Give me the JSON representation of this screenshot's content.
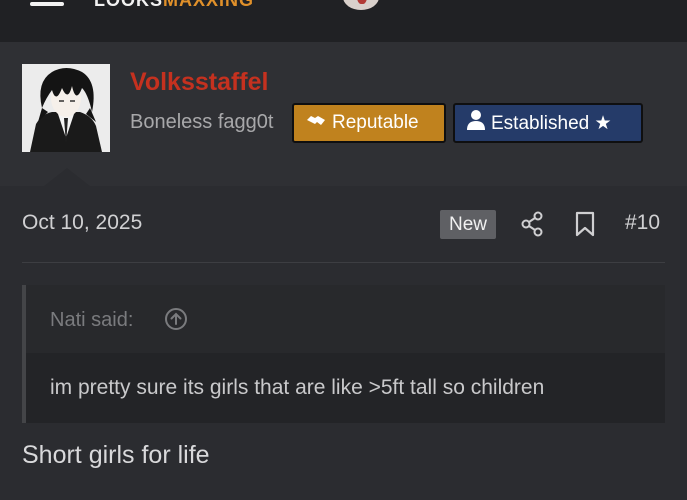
{
  "nav": {
    "logo_part1": "LOOKS",
    "logo_part2": "MAXXING"
  },
  "post": {
    "username": "Volksstaffel",
    "user_title": "Boneless fagg0t",
    "badges": [
      {
        "label": "Reputable",
        "icon": "handshake-icon",
        "color": "#c0821e"
      },
      {
        "label": "Established ★",
        "icon": "user-icon",
        "color": "#253b69"
      }
    ],
    "date": "Oct 10, 2025",
    "new_label": "New",
    "post_number": "#10",
    "quote": {
      "author": "Nati said:",
      "text": "im pretty sure its girls that are like >5ft tall so children"
    },
    "message": "Short girls for life"
  },
  "colors": {
    "username": "#c5311f",
    "background": "#2b2c30",
    "accent_logo": "#e0902a"
  }
}
